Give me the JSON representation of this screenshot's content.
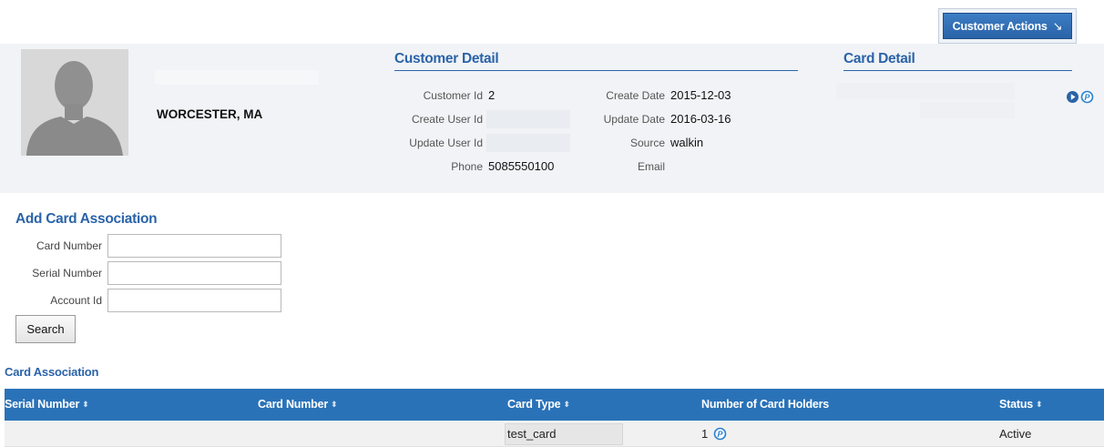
{
  "header": {
    "actions_label": "Customer Actions",
    "actions_arrow": "↘"
  },
  "profile": {
    "location": "WORCESTER, MA"
  },
  "customer_detail": {
    "title": "Customer Detail",
    "fields": {
      "customer_id": {
        "label": "Customer Id",
        "value": "2"
      },
      "create_user_id": {
        "label": "Create User Id",
        "value": ""
      },
      "update_user_id": {
        "label": "Update User Id",
        "value": ""
      },
      "phone": {
        "label": "Phone",
        "value": "5085550100"
      },
      "create_date": {
        "label": "Create Date",
        "value": "2015-12-03"
      },
      "update_date": {
        "label": "Update Date",
        "value": "2016-03-16"
      },
      "source": {
        "label": "Source",
        "value": "walkin"
      },
      "email": {
        "label": "Email",
        "value": ""
      }
    }
  },
  "card_detail": {
    "title": "Card Detail",
    "icons": [
      "play-circle-icon",
      "p-circle-icon"
    ]
  },
  "add_card": {
    "title": "Add Card Association",
    "card_number_label": "Card Number",
    "serial_number_label": "Serial Number",
    "account_id_label": "Account Id",
    "search_label": "Search"
  },
  "card_association": {
    "title": "Card Association",
    "columns": [
      "Serial Number",
      "Card Number",
      "Card Type",
      "Number of Card Holders",
      "Status"
    ],
    "rows": [
      {
        "serial_number": "",
        "card_number": "",
        "card_type": "test_card",
        "holders": "1",
        "status": "Active"
      }
    ]
  },
  "colors": {
    "accent": "#2a63a8",
    "table_header": "#2a72b8",
    "panel_bg": "#f1f3f6"
  }
}
